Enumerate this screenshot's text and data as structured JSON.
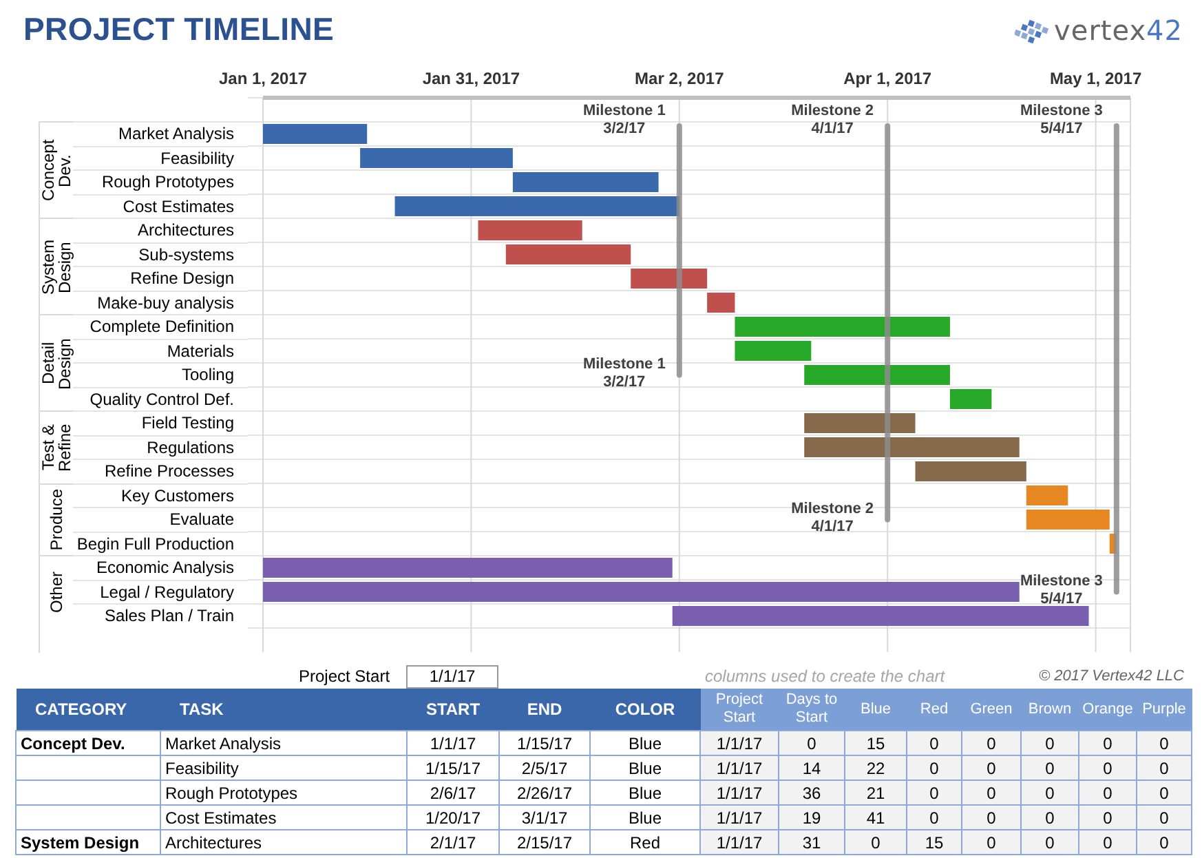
{
  "title": "PROJECT TIMELINE",
  "logo": {
    "word": "vertex",
    "number": "42"
  },
  "chart": {
    "date_labels": [
      "Jan 1, 2017",
      "Jan 31, 2017",
      "Mar 2, 2017",
      "Apr 1, 2017",
      "May 1, 2017"
    ],
    "phases": [
      {
        "label": "Concept Dev.",
        "color": "#3a69ae",
        "children": [
          "Market Analysis",
          "Feasibility",
          "Rough Prototypes",
          "Cost Estimates"
        ]
      },
      {
        "label": "System Design",
        "color": "#c0504d",
        "children": [
          "Architectures",
          "Sub-systems",
          "Refine Design",
          "Make-buy analysis"
        ]
      },
      {
        "label": "Detail Design",
        "color": "#28a828",
        "children": [
          "Complete Definition",
          "Materials",
          "Tooling",
          "Quality Control Def."
        ]
      },
      {
        "label": "Test & Refine",
        "color": "#86684a",
        "children": [
          "Field Testing",
          "Regulations",
          "Refine Processes"
        ]
      },
      {
        "label": "Produce",
        "color": "#e68722",
        "children": [
          "Key Customers",
          "Evaluate",
          "Begin Full Production"
        ]
      },
      {
        "label": "Other",
        "color": "#7a5fb0",
        "children": [
          "Economic Analysis",
          "Legal / Regulatory",
          "Sales Plan / Train"
        ]
      }
    ],
    "milestone_labels": [
      "Milestone 1\n3/2/17",
      "Milestone 2\n4/1/17",
      "Milestone 3\n5/4/17",
      "Milestone 1\n3/2/17",
      "Milestone 2\n4/1/17",
      "Milestone 3\n5/4/17"
    ]
  },
  "project_start": {
    "label": "Project Start",
    "value": "1/1/17"
  },
  "helper_note": "columns used to create the chart",
  "copyright": "© 2017 Vertex42 LLC",
  "table": {
    "columns": [
      {
        "label": "CATEGORY",
        "kind": "input"
      },
      {
        "label": "TASK",
        "kind": "input"
      },
      {
        "label": "START",
        "kind": "input"
      },
      {
        "label": "END",
        "kind": "input"
      },
      {
        "label": "COLOR",
        "kind": "input"
      },
      {
        "label": "Project Start",
        "kind": "helper"
      },
      {
        "label": "Days to Start",
        "kind": "helper"
      },
      {
        "label": "Blue",
        "kind": "helper"
      },
      {
        "label": "Red",
        "kind": "helper"
      },
      {
        "label": "Green",
        "kind": "helper"
      },
      {
        "label": "Brown",
        "kind": "helper"
      },
      {
        "label": "Orange",
        "kind": "helper"
      },
      {
        "label": "Purple",
        "kind": "helper"
      }
    ],
    "rows": [
      {
        "cells": [
          "Concept Dev.",
          "Market Analysis",
          "1/1/17",
          "1/15/17",
          "Blue",
          "1/1/17",
          "0",
          "15",
          "0",
          "0",
          "0",
          "0",
          "0"
        ]
      },
      {
        "cells": [
          "",
          "Feasibility",
          "1/15/17",
          "2/5/17",
          "Blue",
          "1/1/17",
          "14",
          "22",
          "0",
          "0",
          "0",
          "0",
          "0"
        ]
      },
      {
        "cells": [
          "",
          "Rough Prototypes",
          "2/6/17",
          "2/26/17",
          "Blue",
          "1/1/17",
          "36",
          "21",
          "0",
          "0",
          "0",
          "0",
          "0"
        ]
      },
      {
        "cells": [
          "",
          "Cost Estimates",
          "1/20/17",
          "3/1/17",
          "Blue",
          "1/1/17",
          "19",
          "41",
          "0",
          "0",
          "0",
          "0",
          "0"
        ]
      },
      {
        "cells": [
          "System Design",
          "Architectures",
          "2/1/17",
          "2/15/17",
          "Red",
          "1/1/17",
          "31",
          "0",
          "15",
          "0",
          "0",
          "0",
          "0"
        ]
      }
    ]
  }
}
